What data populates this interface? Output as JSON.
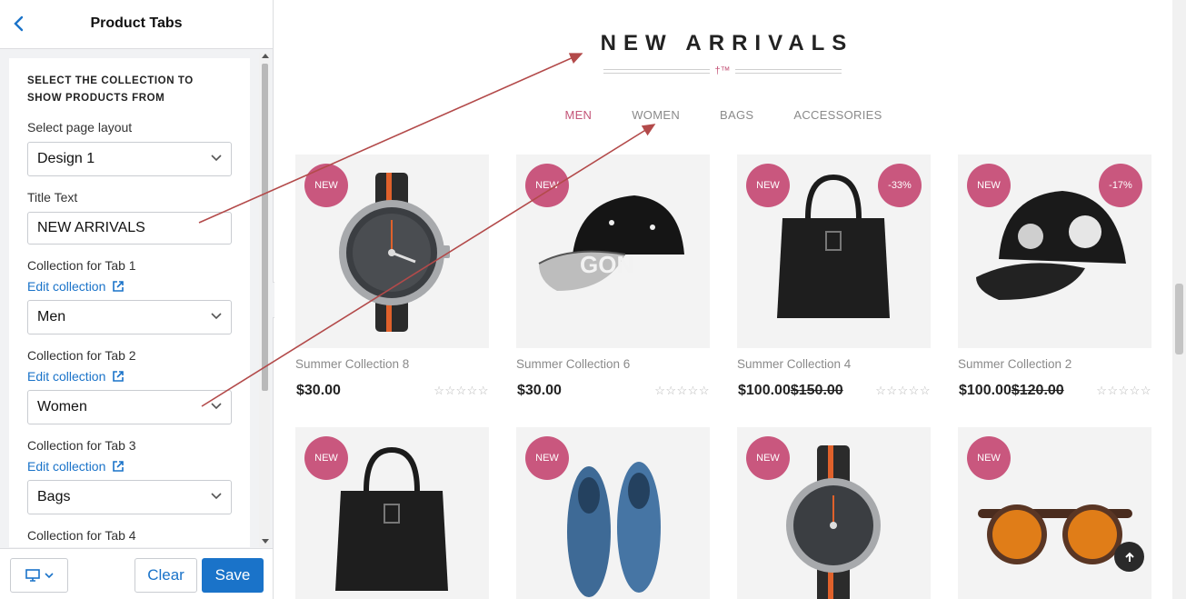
{
  "panel": {
    "title": "Product Tabs",
    "section_heading": "SELECT THE COLLECTION TO SHOW PRODUCTS FROM",
    "layout_label": "Select page layout",
    "layout_value": "Design 1",
    "title_text_label": "Title Text",
    "title_text_value": "NEW ARRIVALS",
    "edit_collection": "Edit collection",
    "tab1_label": "Collection for Tab 1",
    "tab1_value": "Men",
    "tab2_label": "Collection for Tab 2",
    "tab2_value": "Women",
    "tab3_label": "Collection for Tab 3",
    "tab3_value": "Bags",
    "tab4_label": "Collection for Tab 4",
    "clear_label": "Clear",
    "save_label": "Save"
  },
  "preview": {
    "section_title": "NEW ARRIVALS",
    "title_mark": "†™",
    "tabs": [
      "MEN",
      "WOMEN",
      "BAGS",
      "ACCESSORIES"
    ],
    "active_tab": "MEN",
    "products": [
      {
        "name": "Summer Collection 8",
        "price": "$30.00",
        "old_price": "",
        "badge": "NEW",
        "discount": "",
        "image": "wristwatch"
      },
      {
        "name": "Summer Collection 6",
        "price": "$30.00",
        "old_price": "",
        "badge": "NEW",
        "discount": "",
        "image": "snapback-cap"
      },
      {
        "name": "Summer Collection 4",
        "price": "$100.00",
        "old_price": "$150.00",
        "badge": "NEW",
        "discount": "-33%",
        "image": "leather-tote-bag"
      },
      {
        "name": "Summer Collection 2",
        "price": "$100.00",
        "old_price": "$120.00",
        "badge": "NEW",
        "discount": "-17%",
        "image": "black-cap"
      },
      {
        "name": "",
        "price": "",
        "old_price": "",
        "badge": "NEW",
        "discount": "",
        "image": "leather-tote-bag"
      },
      {
        "name": "",
        "price": "",
        "old_price": "",
        "badge": "NEW",
        "discount": "",
        "image": "denim-shoes"
      },
      {
        "name": "",
        "price": "",
        "old_price": "",
        "badge": "NEW",
        "discount": "",
        "image": "wristwatch"
      },
      {
        "name": "",
        "price": "",
        "old_price": "",
        "badge": "NEW",
        "discount": "",
        "image": "sunglasses"
      }
    ],
    "stars": "☆☆☆☆☆"
  },
  "colors": {
    "accent_pink": "#c9577e",
    "link_blue": "#1a73c9",
    "annotation_arrow": "#b34a4a"
  }
}
